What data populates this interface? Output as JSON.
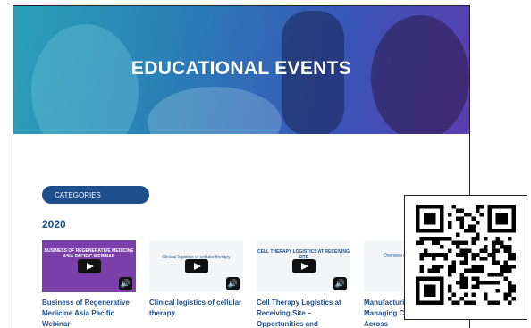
{
  "hero": {
    "title": "EDUCATIONAL EVENTS"
  },
  "categories_label": "CATEGORIES",
  "year": "2020",
  "events": [
    {
      "title": "Business of Regenerative Medicine Asia Pacific Webinar",
      "thumb_heading": "BUSINESS OF REGENERATIVE MEDICINE ASIA PACIFIC WEBINAR"
    },
    {
      "title": "Clinical logistics of cellular therapy",
      "thumb_heading": "Clinical logistics of cellular therapy"
    },
    {
      "title": "Cell Therapy Logistics at Receiving Site – Opportunities and Challenges",
      "thumb_heading": "CELL THERAPY LOGISTICS AT RECEIVING SITE"
    },
    {
      "title": "Manufacturin Solutions for Managing Complexity Across",
      "thumb_heading": "Overview of Ma and Solutio"
    }
  ],
  "icons": {
    "play": "play-icon",
    "volume": "volume-icon",
    "qr": "qr-code"
  }
}
